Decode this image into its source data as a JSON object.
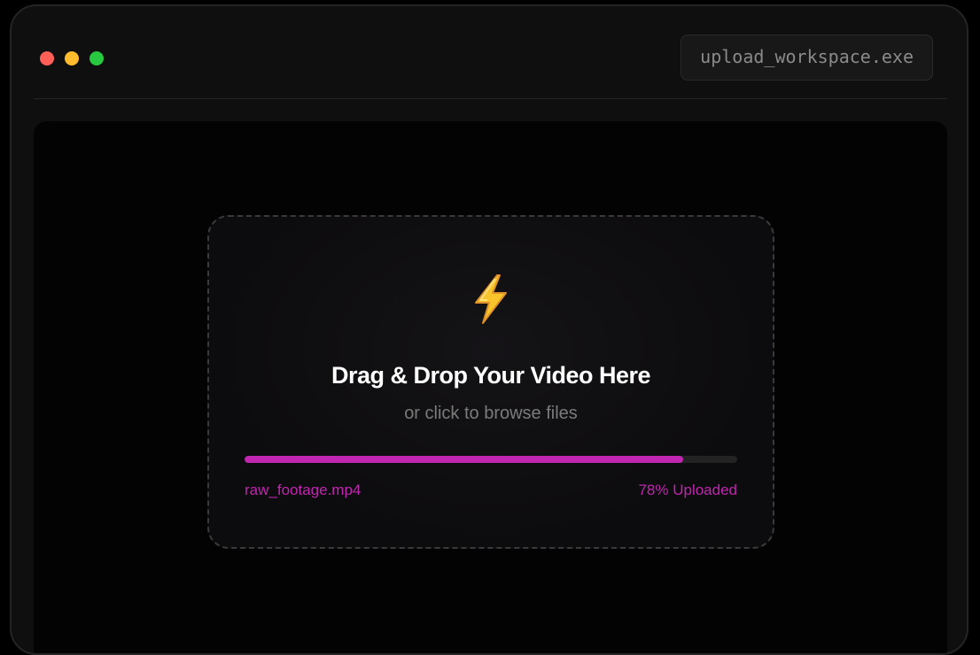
{
  "window": {
    "title": "upload_workspace.exe",
    "controls": [
      {
        "name": "close",
        "color": "#ff5f57"
      },
      {
        "name": "minimize",
        "color": "#febc2e"
      },
      {
        "name": "maximize",
        "color": "#28c840"
      }
    ]
  },
  "dropzone": {
    "icon": "lightning-bolt-icon",
    "title": "Drag & Drop Your Video Here",
    "subtitle": "or click to browse files",
    "file_name": "raw_footage.mp4",
    "progress_percent": 89,
    "status": "78% Uploaded",
    "accent_color": "#c026b0"
  }
}
